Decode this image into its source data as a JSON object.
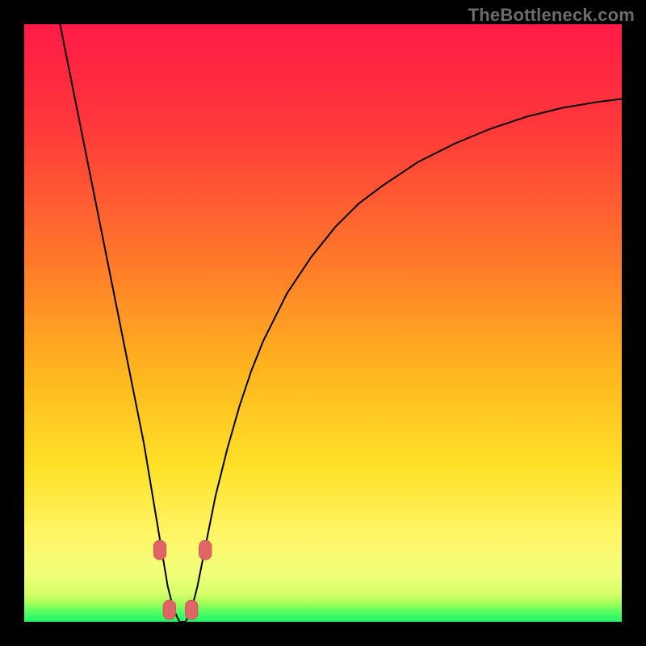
{
  "watermark": "TheBottleneck.com",
  "colors": {
    "frame": "#000000",
    "curve": "#000000",
    "marker_fill": "#e06666",
    "marker_stroke": "#c85252",
    "gradient_stops": [
      {
        "offset": 0.0,
        "color": "#ff1a46"
      },
      {
        "offset": 0.18,
        "color": "#ff3a3a"
      },
      {
        "offset": 0.4,
        "color": "#ff7a2a"
      },
      {
        "offset": 0.58,
        "color": "#ffb51f"
      },
      {
        "offset": 0.74,
        "color": "#ffe128"
      },
      {
        "offset": 0.86,
        "color": "#fff66a"
      },
      {
        "offset": 0.92,
        "color": "#f1ff7a"
      },
      {
        "offset": 0.952,
        "color": "#d8ff6a"
      },
      {
        "offset": 0.968,
        "color": "#a8ff5a"
      },
      {
        "offset": 0.982,
        "color": "#5cff60"
      },
      {
        "offset": 1.0,
        "color": "#1ef56a"
      }
    ]
  },
  "chart_data": {
    "type": "line",
    "title": "",
    "xlabel": "",
    "ylabel": "",
    "xlim": [
      0,
      100
    ],
    "ylim": [
      0,
      100
    ],
    "x_min_at": 26,
    "series": [
      {
        "name": "bottleneck-curve",
        "x": [
          6,
          8,
          10,
          12,
          14,
          16,
          18,
          20,
          21,
          22,
          23,
          24,
          25,
          26,
          27,
          28,
          29,
          30,
          31,
          32,
          34,
          36,
          38,
          40,
          44,
          48,
          52,
          56,
          60,
          66,
          72,
          78,
          84,
          90,
          96,
          100
        ],
        "values": [
          100,
          90,
          80,
          70,
          60,
          50,
          40,
          30,
          24,
          18,
          12,
          6,
          2,
          0,
          0,
          2,
          6,
          11,
          16,
          21,
          29,
          36,
          42,
          47,
          55,
          61,
          66,
          70,
          73,
          77,
          80,
          82.5,
          84.5,
          86,
          87,
          87.5
        ]
      }
    ],
    "markers": [
      {
        "x": 22.7,
        "y": 12
      },
      {
        "x": 30.3,
        "y": 12
      },
      {
        "x": 24.3,
        "y": 2
      },
      {
        "x": 28.0,
        "y": 2
      }
    ]
  }
}
